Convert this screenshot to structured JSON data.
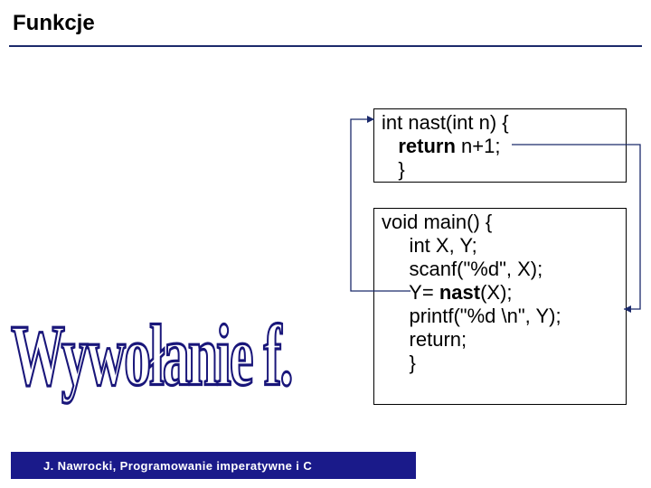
{
  "header": {
    "title": "Funkcje"
  },
  "code": {
    "nast": {
      "line1_a": "int nast(int n) {",
      "line2_kw": "return",
      "line2_rest": " n+1;",
      "line3": "   }"
    },
    "main": {
      "line1": "void main() {",
      "line2": "     int X, Y;",
      "line3": "     scanf(\"%d\", X);",
      "line4_a": "     Y= ",
      "line4_kw": "nast",
      "line4_b": "(X);",
      "line5": "     printf(\"%d \\n\", Y);",
      "line6": "     return;",
      "line7": "     }"
    }
  },
  "wordart": {
    "text": "Wywołanie f."
  },
  "footer": {
    "text": "J. Nawrocki, Programowanie imperatywne i C"
  }
}
